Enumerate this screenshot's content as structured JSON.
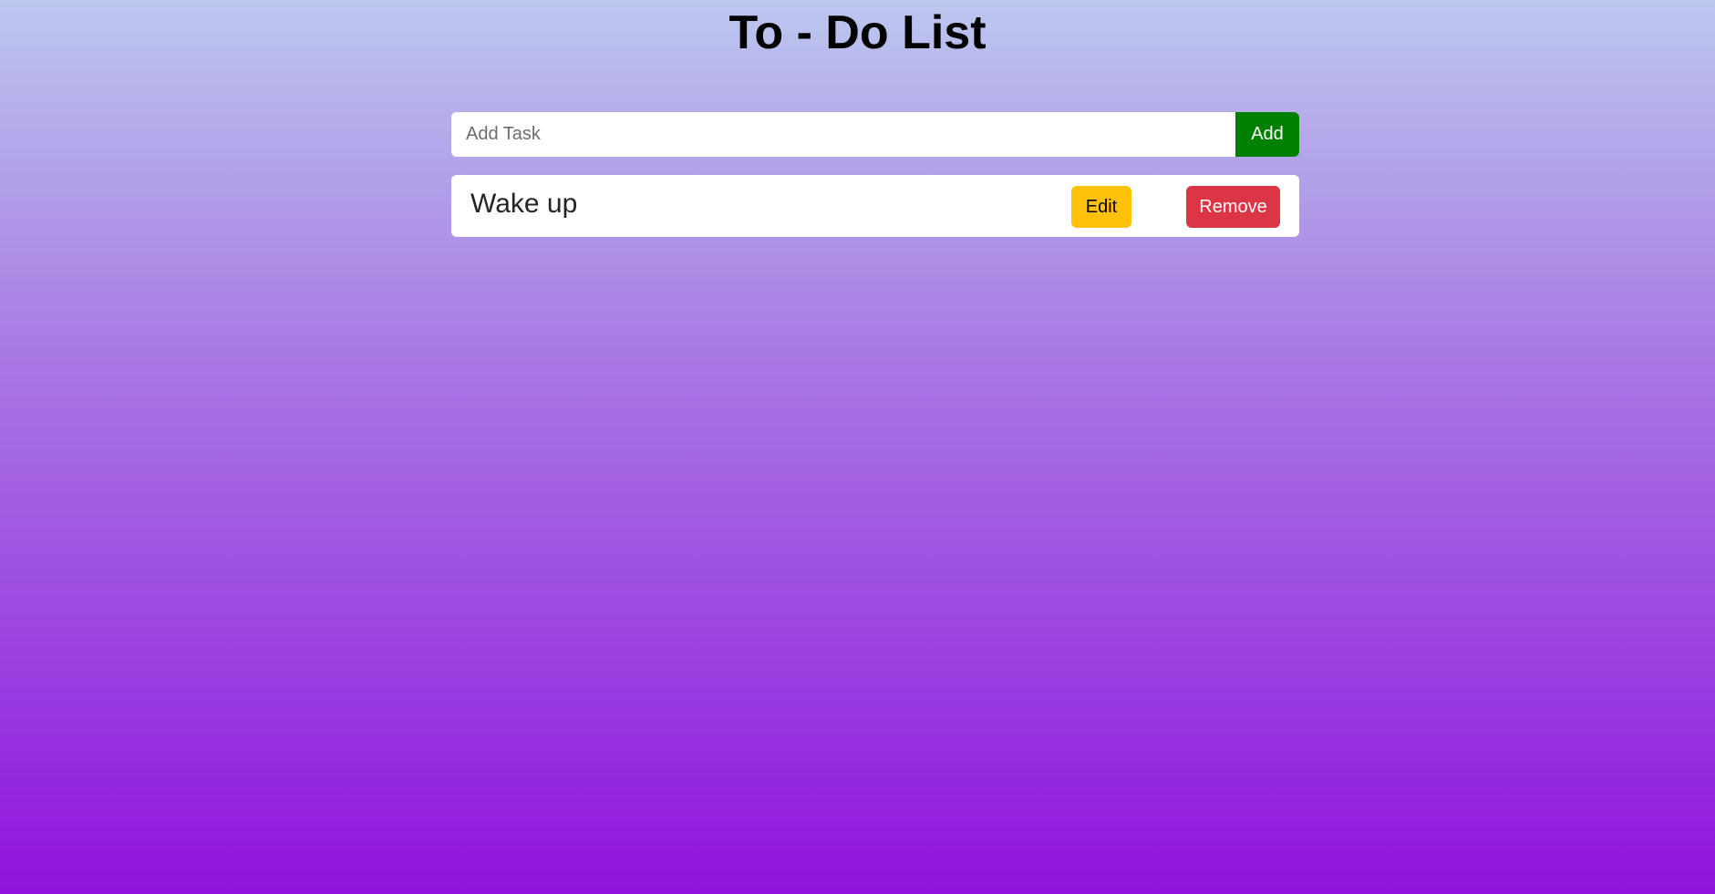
{
  "header": {
    "title": "To - Do List"
  },
  "task_input": {
    "placeholder": "Add Task",
    "value": "",
    "add_label": "Add"
  },
  "tasks": [
    {
      "text": "Wake up",
      "edit_label": "Edit",
      "remove_label": "Remove"
    }
  ],
  "colors": {
    "add_button": "#008000",
    "edit_button": "#ffc107",
    "remove_button": "#dc3545",
    "background_top": "#bcc8ee",
    "background_bottom": "#9012dc"
  }
}
